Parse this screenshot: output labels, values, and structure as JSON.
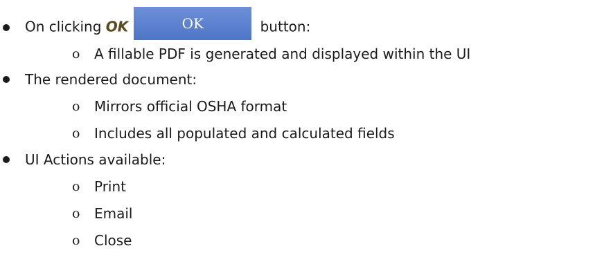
{
  "items": [
    {
      "prefix": "On clicking ",
      "emphasis": "OK",
      "button_label": "OK",
      "suffix": " button:",
      "subitems": [
        "A fillable PDF is generated and displayed within the UI"
      ]
    },
    {
      "text": "The rendered document:",
      "subitems": [
        "Mirrors official OSHA format",
        "Includes all populated and calculated fields"
      ]
    },
    {
      "text": "UI Actions available:",
      "subitems": [
        "Print",
        "Email",
        "Close"
      ]
    }
  ],
  "sub_bullet_glyph": "o",
  "colors": {
    "button_bg": "#5b80cc",
    "button_text": "#ffffff",
    "emphasis": "#5a4a1c",
    "text": "#1a1a1a"
  }
}
